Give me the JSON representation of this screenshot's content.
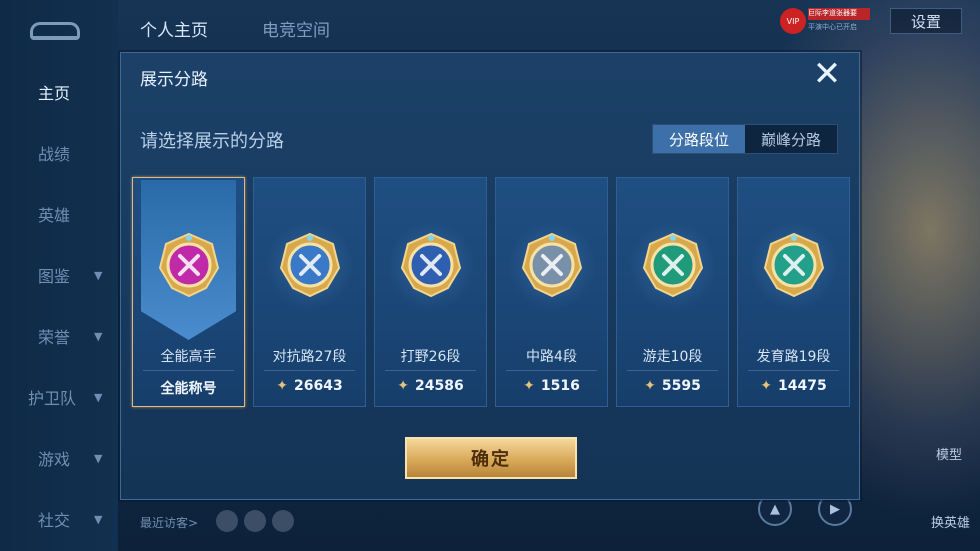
{
  "top_tabs": [
    {
      "label": "个人主页",
      "active": true
    },
    {
      "label": "电竞空间",
      "active": false
    }
  ],
  "settings_label": "设置",
  "vip": {
    "label": "VIP",
    "badge": "巨际李道张器要",
    "sub": "平演中心已开启"
  },
  "sidebar": [
    {
      "label": "主页",
      "active": true,
      "chevron": false
    },
    {
      "label": "战绩",
      "active": false,
      "chevron": false
    },
    {
      "label": "英雄",
      "active": false,
      "chevron": false
    },
    {
      "label": "图鉴",
      "active": false,
      "chevron": true
    },
    {
      "label": "荣誉",
      "active": false,
      "chevron": true
    },
    {
      "label": "护卫队",
      "active": false,
      "chevron": true
    },
    {
      "label": "游戏",
      "active": false,
      "chevron": true
    },
    {
      "label": "社交",
      "active": false,
      "chevron": true
    }
  ],
  "recent_visitors": "最近访客>",
  "right_side": {
    "model": "模型",
    "change_hero": "换英雄"
  },
  "modal": {
    "title": "展示分路",
    "close_icon": "close-icon",
    "subtitle": "请选择展示的分路",
    "toggle": [
      {
        "label": "分路段位",
        "active": true
      },
      {
        "label": "巅峰分路",
        "active": false
      }
    ],
    "cards": [
      {
        "label": "全能高手",
        "value": "全能称号",
        "selected": true,
        "icon": "all-round-emblem",
        "color": "#c02aa8",
        "show_score_icon": false
      },
      {
        "label": "对抗路27段",
        "value": "26643",
        "selected": false,
        "icon": "clash-lane-emblem",
        "color": "#3a78c8",
        "show_score_icon": true
      },
      {
        "label": "打野26段",
        "value": "24586",
        "selected": false,
        "icon": "jungle-emblem",
        "color": "#2f5fb0",
        "show_score_icon": true
      },
      {
        "label": "中路4段",
        "value": "1516",
        "selected": false,
        "icon": "mid-lane-emblem",
        "color": "#7890a8",
        "show_score_icon": true
      },
      {
        "label": "游走10段",
        "value": "5595",
        "selected": false,
        "icon": "roam-emblem",
        "color": "#1f9a7a",
        "show_score_icon": true
      },
      {
        "label": "发育路19段",
        "value": "14475",
        "selected": false,
        "icon": "farm-lane-emblem",
        "color": "#22a08a",
        "show_score_icon": true
      }
    ],
    "confirm_label": "确定"
  },
  "colors": {
    "accent_gold": "#e7c27a",
    "toggle_active": "#3d6fa8",
    "selected_border": "#e8b878"
  }
}
